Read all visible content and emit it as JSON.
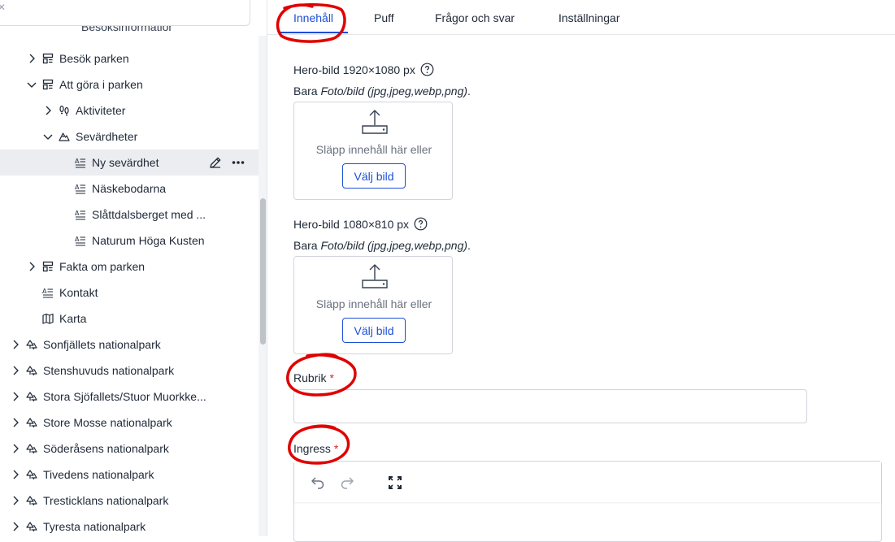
{
  "sidebar": {
    "cut_row_text": "Besöksinformation",
    "tree": [
      {
        "label": "Besök parken",
        "icon": "layout-icon",
        "chevron": "right",
        "level": 1
      },
      {
        "label": "Att göra i parken",
        "icon": "layout-icon",
        "chevron": "down",
        "level": 1
      },
      {
        "label": "Aktiviteter",
        "icon": "footsteps-icon",
        "chevron": "right",
        "level": 2
      },
      {
        "label": "Sevärdheter",
        "icon": "mountain-icon",
        "chevron": "down",
        "level": 2
      },
      {
        "label": "Ny sevärdhet",
        "icon": "article-icon",
        "chevron": "none",
        "level": 3,
        "selected": true
      },
      {
        "label": "Näskebodarna",
        "icon": "article-icon",
        "chevron": "none",
        "level": 3
      },
      {
        "label": "Slåttdalsberget med ...",
        "icon": "article-icon",
        "chevron": "none",
        "level": 3
      },
      {
        "label": "Naturum Höga Kusten",
        "icon": "article-icon",
        "chevron": "none",
        "level": 3
      },
      {
        "label": "Fakta om parken",
        "icon": "layout-icon",
        "chevron": "right",
        "level": 1
      },
      {
        "label": "Kontakt",
        "icon": "article-icon",
        "chevron": "none",
        "level": 1
      },
      {
        "label": "Karta",
        "icon": "map-icon",
        "chevron": "none",
        "level": 1
      },
      {
        "label": "Sonfjällets nationalpark",
        "icon": "park-icon",
        "chevron": "right",
        "level": 0
      },
      {
        "label": "Stenshuvuds nationalpark",
        "icon": "park-icon",
        "chevron": "right",
        "level": 0
      },
      {
        "label": "Stora Sjöfallets/Stuor Muorkke...",
        "icon": "park-icon",
        "chevron": "right",
        "level": 0
      },
      {
        "label": "Store Mosse nationalpark",
        "icon": "park-icon",
        "chevron": "right",
        "level": 0
      },
      {
        "label": "Söderåsens nationalpark",
        "icon": "park-icon",
        "chevron": "right",
        "level": 0
      },
      {
        "label": "Tivedens nationalpark",
        "icon": "park-icon",
        "chevron": "right",
        "level": 0
      },
      {
        "label": "Tresticklans nationalpark",
        "icon": "park-icon",
        "chevron": "right",
        "level": 0
      },
      {
        "label": "Tyresta nationalpark",
        "icon": "park-icon",
        "chevron": "right",
        "level": 0
      }
    ]
  },
  "tabs": [
    {
      "label": "Innehåll",
      "active": true
    },
    {
      "label": "Puff",
      "active": false
    },
    {
      "label": "Frågor och svar",
      "active": false
    },
    {
      "label": "Inställningar",
      "active": false
    }
  ],
  "form": {
    "hero1": {
      "label": "Hero-bild 1920×1080 px",
      "hint_prefix": "Bara ",
      "hint_italic": "Foto/bild (jpg,jpeg,webp,png)",
      "hint_suffix": ".",
      "drop_text": "Släpp innehåll här eller",
      "button": "Välj bild"
    },
    "hero2": {
      "label": "Hero-bild 1080×810 px",
      "hint_prefix": "Bara ",
      "hint_italic": "Foto/bild (jpg,jpeg,webp,png)",
      "hint_suffix": ".",
      "drop_text": "Släpp innehåll här eller",
      "button": "Välj bild"
    },
    "rubrik": {
      "label": "Rubrik",
      "required_mark": "*",
      "value": ""
    },
    "ingress": {
      "label": "Ingress",
      "required_mark": "*"
    }
  },
  "colors": {
    "accent": "#1d4ed8",
    "required": "#dc2626",
    "selected_row": "#ebedf0",
    "annotation": "#e00000"
  }
}
